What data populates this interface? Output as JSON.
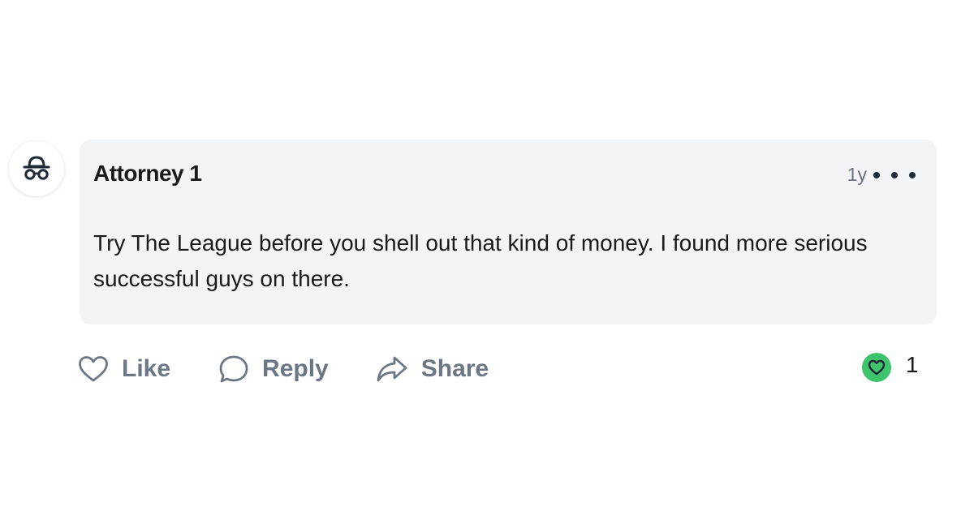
{
  "comment": {
    "author": "Attorney 1",
    "timestamp": "1y",
    "body": "Try The League before you shell out that kind of money. I found more serious successful guys on there.",
    "avatar_icon": "incognito-icon"
  },
  "actions": {
    "like_label": "Like",
    "reply_label": "Reply",
    "share_label": "Share",
    "like_icon": "heart-outline-icon",
    "reply_icon": "speech-bubble-icon",
    "share_icon": "share-arrow-icon"
  },
  "reactions": {
    "icon": "heart-filled-icon",
    "count": "1",
    "badge_color": "#3ec46d"
  },
  "more_menu_icon": "ellipsis-icon"
}
